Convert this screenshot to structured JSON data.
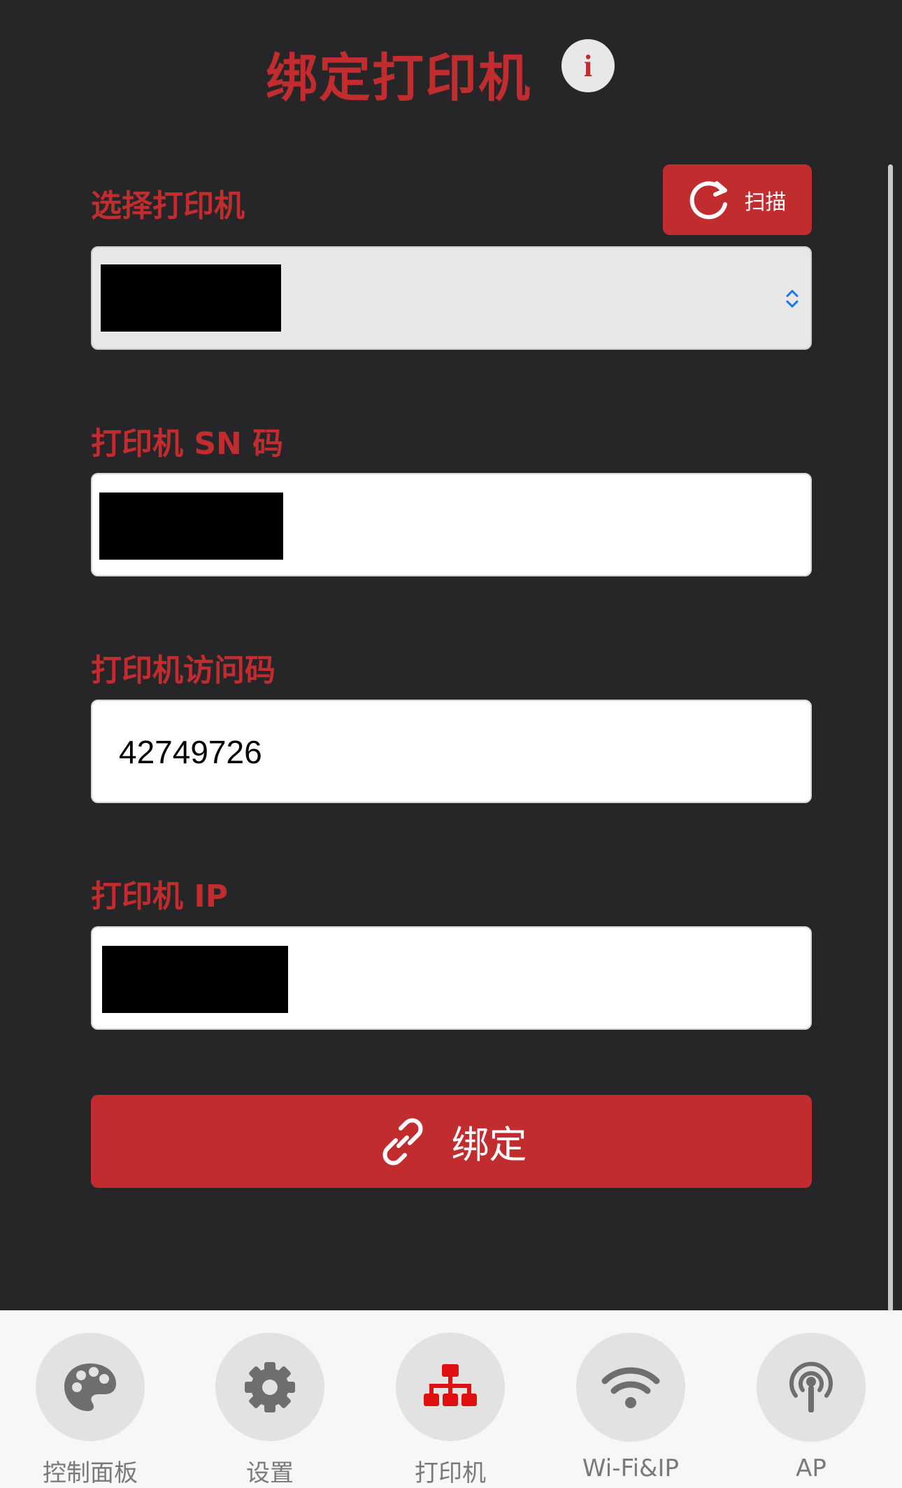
{
  "header": {
    "title": "绑定打印机",
    "info_label": "i"
  },
  "select_printer": {
    "label": "选择打印机",
    "scan_label": "扫描"
  },
  "sn": {
    "label": "打印机 SN 码"
  },
  "access_code": {
    "label": "打印机访问码",
    "value": "42749726"
  },
  "ip": {
    "label": "打印机 IP"
  },
  "bind_button": {
    "label": "绑定"
  },
  "tabs": [
    {
      "label": "控制面板",
      "icon": "palette-icon"
    },
    {
      "label": "设置",
      "icon": "gear-icon"
    },
    {
      "label": "打印机",
      "icon": "sitemap-icon",
      "active": true
    },
    {
      "label": "Wi-Fi&IP",
      "icon": "wifi-icon"
    },
    {
      "label": "AP",
      "icon": "broadcast-tower-icon"
    }
  ],
  "colors": {
    "background": "#262527",
    "accent": "#c12c2f",
    "active_tab_icon": "#e01010",
    "inactive_icon": "#6e6e6e"
  }
}
